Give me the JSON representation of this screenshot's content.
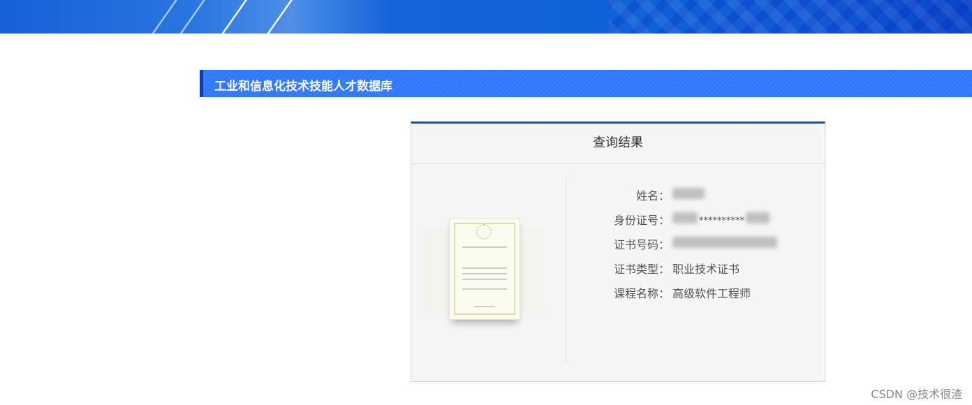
{
  "header": {
    "title": "工业和信息化技术技能人才数据库"
  },
  "result": {
    "title": "查询结果",
    "fields": [
      {
        "label": "姓名：",
        "value": ""
      },
      {
        "label": "身份证号：",
        "value": "**********"
      },
      {
        "label": "证书号码：",
        "value": ""
      },
      {
        "label": "证书类型：",
        "value": "职业技术证书"
      },
      {
        "label": "课程名称：",
        "value": "高级软件工程师"
      }
    ]
  },
  "watermark": "CSDN @技术很渣"
}
